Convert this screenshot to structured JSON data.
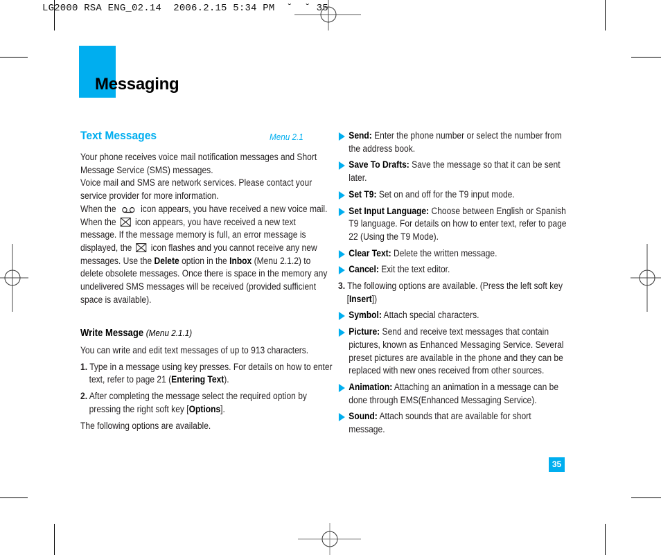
{
  "slug_line": "LG2000 RSA ENG_02.14  2006.2.15 5:34 PM  ˘  ˘ 35",
  "colors": {
    "accent": "#00aeef",
    "text": "#231f20"
  },
  "header": {
    "title": "Messaging"
  },
  "section": {
    "title": "Text Messages",
    "menu_ref": "Menu 2.1"
  },
  "intro": {
    "p1": "Your phone receives voice mail notification messages and Short Message Service (SMS) messages.",
    "p2": "Voice mail and SMS are network services. Please contact your service provider for more information.",
    "when_the": "When the",
    "voicemail_icon": "voicemail-icon",
    "after_voicemail": "icon appears, you have received a new voice mail. When the",
    "envelope_icon": "envelope-icon",
    "after_envelope": "icon appears, you have received a new text message. If the message memory is full, an error message is displayed, the",
    "after_envelope2": "icon flashes and you cannot receive any new messages.",
    "use_the": "Use the",
    "delete": "Delete",
    "option_in": "option in the",
    "inbox": "Inbox",
    "rest": "(Menu 2.1.2) to delete obsolete messages. Once there is space in the memory any undelivered SMS messages will be received (provided sufficient space is available)."
  },
  "write_message": {
    "title": "Write Message",
    "menu_ref": "(Menu 2.1.1)",
    "p1": "You can write and edit text messages of up to 913 characters.",
    "step1_num": "1.",
    "step1_text": "Type in a message using key presses. For details on how to enter text, refer to page 21 (",
    "step1_bold": "Entering Text",
    "step1_end": ").",
    "step2_num": "2.",
    "step2_text": "After completing the message select the required option by pressing the right soft key [",
    "step2_bold": "Options",
    "step2_end": "].",
    "following": "The following options are available."
  },
  "options": [
    {
      "label": "Send:",
      "text": "Enter the phone number or select the number from the address book."
    },
    {
      "label": "Save To Drafts:",
      "text": "Save the message so that it can be sent later."
    },
    {
      "label": "Set T9:",
      "text": "Set on and off for the T9 input mode."
    },
    {
      "label": "Set Input Language:",
      "text": "Choose between English or Spanish T9 language. For details on how to enter text, refer to page 22 (Using the T9 Mode)."
    },
    {
      "label": "Clear Text:",
      "text": "Delete the written message."
    },
    {
      "label": "Cancel:",
      "text": "Exit the text editor."
    }
  ],
  "step3": {
    "num": "3.",
    "text": "The following options are available. (Press the left soft key [",
    "bold": "Insert",
    "end": "])"
  },
  "insert_options": [
    {
      "label": "Symbol:",
      "text": "Attach special characters."
    },
    {
      "label": "Picture:",
      "text": "Send and receive text messages that contain pictures, known as Enhanced Messaging Service. Several preset pictures are available in the phone and they can be replaced with new ones received from other sources."
    },
    {
      "label": "Animation:",
      "text": "Attaching an animation in a message can be done through EMS(Enhanced Messaging Service)."
    },
    {
      "label": "Sound:",
      "text": "Attach sounds that are available for short message."
    }
  ],
  "page_number": "35"
}
